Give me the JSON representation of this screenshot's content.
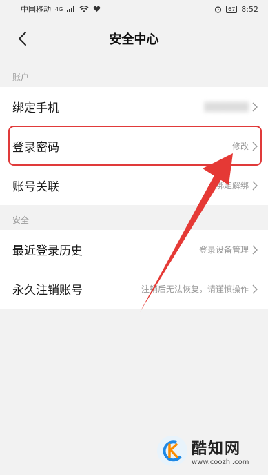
{
  "status_bar": {
    "carrier": "中国移动",
    "network": "4G",
    "battery": "67",
    "time": "8:52"
  },
  "nav": {
    "title": "安全中心"
  },
  "sections": {
    "account": {
      "label": "账户",
      "rows": [
        {
          "label": "绑定手机",
          "value": ""
        },
        {
          "label": "登录密码",
          "value": "修改"
        },
        {
          "label": "账号关联",
          "value": "绑定解绑"
        }
      ]
    },
    "security": {
      "label": "安全",
      "rows": [
        {
          "label": "最近登录历史",
          "value": "登录设备管理"
        },
        {
          "label": "永久注销账号",
          "value": "注销后无法恢复，请谨慎操作"
        }
      ]
    }
  },
  "watermark": {
    "name": "酷知网",
    "url": "www.coozhi.com"
  },
  "colors": {
    "highlight": "#e03a3a",
    "arrow": "#e53935"
  }
}
